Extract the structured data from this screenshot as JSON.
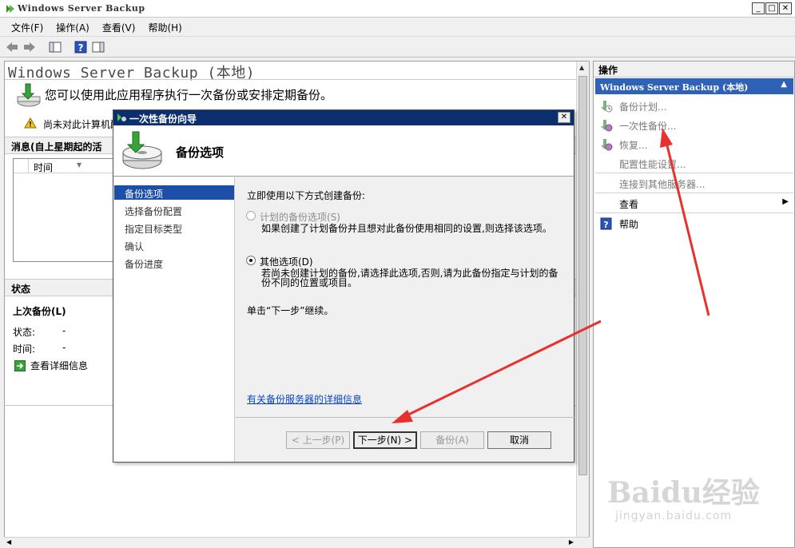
{
  "window": {
    "title": "Windows Server Backup",
    "controls": {
      "minimize": "_",
      "maximize": "□",
      "close": "✕"
    }
  },
  "menu": [
    "文件(F)",
    "操作(A)",
    "查看(V)",
    "帮助(H)"
  ],
  "toolbar": {
    "icons": [
      "back-arrow-icon",
      "forward-arrow-icon",
      "console-tree-icon",
      "help-icon",
      "show-action-pane-icon"
    ]
  },
  "main": {
    "title": "Windows Server Backup (本地)",
    "intro": "您可以使用此应用程序执行一次备份或安排定期备份。",
    "warning": "尚未对此计算机配",
    "messages_header": "消息(自上星期起的活",
    "messages_col_time": "时间",
    "status_header": "状态",
    "last_backup_label": "上次备份(L)",
    "status_label": "状态:",
    "status_value": "-",
    "time_label": "时间:",
    "time_value": "-",
    "view_details": "查看详细信息"
  },
  "actions": {
    "header": "操作",
    "group": "Windows Server Backup (本地)",
    "items": [
      {
        "label": "备份计划...",
        "enabled": false,
        "icon": "backup-schedule-icon"
      },
      {
        "label": "一次性备份...",
        "enabled": false,
        "icon": "backup-once-icon"
      },
      {
        "label": "恢复...",
        "enabled": false,
        "icon": "recover-icon"
      },
      {
        "label": "配置性能设置...",
        "enabled": false,
        "icon": ""
      },
      {
        "label": "连接到其他服务器...",
        "enabled": false,
        "icon": ""
      },
      {
        "label": "查看",
        "enabled": true,
        "icon": ""
      },
      {
        "label": "帮助",
        "enabled": true,
        "icon": "help-icon"
      }
    ]
  },
  "dialog": {
    "title": "一次性备份向导",
    "close": "✕",
    "banner_title": "备份选项",
    "nav": [
      "备份选项",
      "选择备份配置",
      "指定目标类型",
      "确认",
      "备份进度"
    ],
    "active_nav_index": 0,
    "lead": "立即使用以下方式创建备份:",
    "option1_label": "计划的备份选项(S)",
    "option1_desc": "如果创建了计划备份并且想对此备份使用相同的设置,则选择该选项。",
    "option2_label": "其他选项(D)",
    "option2_desc": "若尚未创建计划的备份,请选择此选项,否则,请为此备份指定与计划的备份不同的位置或项目。",
    "selected_option": 2,
    "continue_text": "单击“下一步”继续。",
    "info_link": "有关备份服务器的详细信息",
    "buttons": {
      "prev": "< 上一步(P)",
      "next": "下一步(N) >",
      "backup": "备份(A)",
      "cancel": "取消"
    }
  },
  "watermark": {
    "brand": "Baidu经验",
    "url": "jingyan.baidu.com"
  },
  "colors": {
    "dialog_title_bg": "#0b2e6e",
    "nav_active_bg": "#1e4fa8",
    "actions_group_bg": "#2f62b6",
    "annotation_arrow": "#e8302e",
    "link": "#0a45c0"
  }
}
